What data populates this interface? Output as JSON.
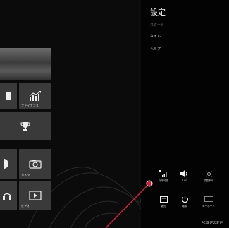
{
  "settings_panel": {
    "title": "設定",
    "items": [
      {
        "label": "スタート",
        "dim": true
      },
      {
        "label": "タイル",
        "dim": false
      },
      {
        "label": "ヘルプ",
        "dim": false
      }
    ]
  },
  "tiles": {
    "finance_label": "ファイナンス",
    "camera_label": "カメラ",
    "video_label": "ビデオ"
  },
  "quick_settings": {
    "network_label": "利用可能",
    "volume_label": "100",
    "brightness_label": "調整不可",
    "notifications_label": "通知",
    "power_label": "電源",
    "keyboard_label": "キーボード"
  },
  "change_pc_settings": "PC 設定の変更",
  "colors": {
    "panel_bg": "#030303",
    "tile_bg": "#3a3a3a",
    "pointer": "#d02040"
  }
}
